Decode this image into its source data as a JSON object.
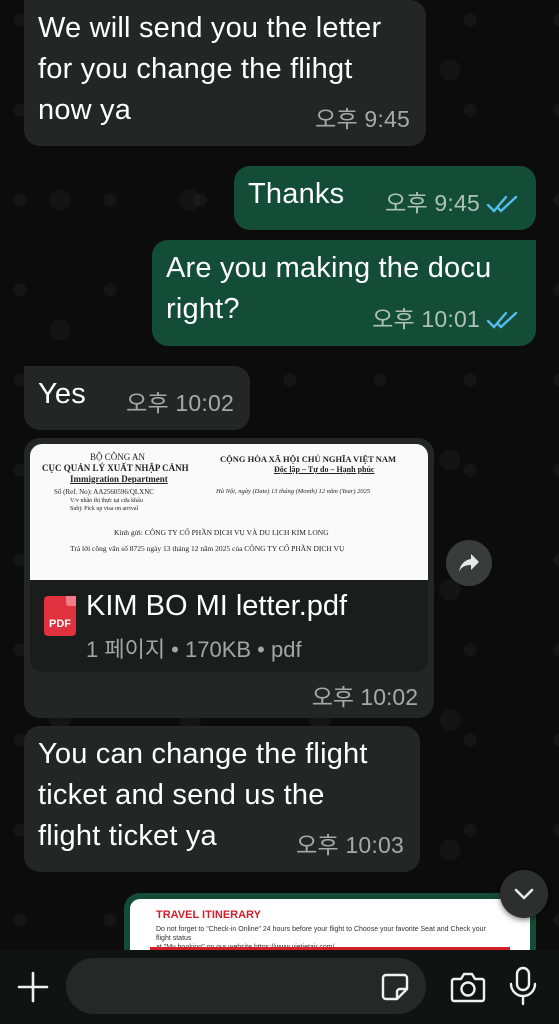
{
  "messages": [
    {
      "text": "We will send you the letter\nfor you change the flihgt\nnow ya",
      "time": "오후 9:45"
    },
    {
      "text": "Thanks",
      "time": "오후 9:45"
    },
    {
      "text": "Are you making the docu\nright?",
      "time": "오후 10:01"
    },
    {
      "text": "Yes",
      "time": "오후 10:02"
    },
    {
      "text": "You can  change the flight\nticket and send us the\nflight ticket ya",
      "time": "오후 10:03"
    }
  ],
  "document": {
    "name": "KIM BO MI letter.pdf",
    "meta": "1 페이지 • 170KB • pdf",
    "time": "오후 10:02",
    "pdf_label": "PDF",
    "preview": {
      "left_header_1": "BỘ CÔNG AN",
      "left_header_2": "CỤC QUẢN LÝ XUẤT NHẬP CẢNH",
      "left_header_3": "Immigration Department",
      "left_ref": "Số (Ref. No): AA2560596/QLXNC",
      "left_sub_1": "V/v nhân thị thực tại cửa khẩu",
      "left_sub_2": "Subj: Pick up visa on arrival",
      "right_header_1": "CỘNG HÒA XÃ HỘI CHỦ NGHĨA VIỆT NAM",
      "right_header_2": "Độc lập – Tự do – Hạnh phúc",
      "right_date": "Hà Nội, ngày (Date) 13 tháng (Month) 12 năm (Year) 2025",
      "body_1": "Kính gửi: CÔNG TY CỔ PHẦN DỊCH VỤ VÀ DU LỊCH KIM LONG",
      "body_2": "Trả lời công văn số 8725 ngày 13 tháng 12 năm 2025 của CÔNG TY CỔ PHẦN DỊCH VỤ"
    }
  },
  "itinerary": {
    "title": "TRAVEL ITINERARY",
    "line_1": "Do not forget to \"Check-in Online\" 24 hours before your flight to Choose your favorite Seat and Check your flight status",
    "line_2": "at \"My booking\" on our website https://www.vietjetair.com/"
  },
  "input": {
    "placeholder": ""
  },
  "colors": {
    "incoming": "#242626",
    "outgoing": "#144d37",
    "read_ticks": "#53bdeb",
    "pdf": "#e0313e"
  },
  "icons": [
    "plus-icon",
    "sticker-icon",
    "camera-icon",
    "microphone-icon",
    "forward-icon",
    "chevron-down-icon",
    "double-check-icon"
  ]
}
